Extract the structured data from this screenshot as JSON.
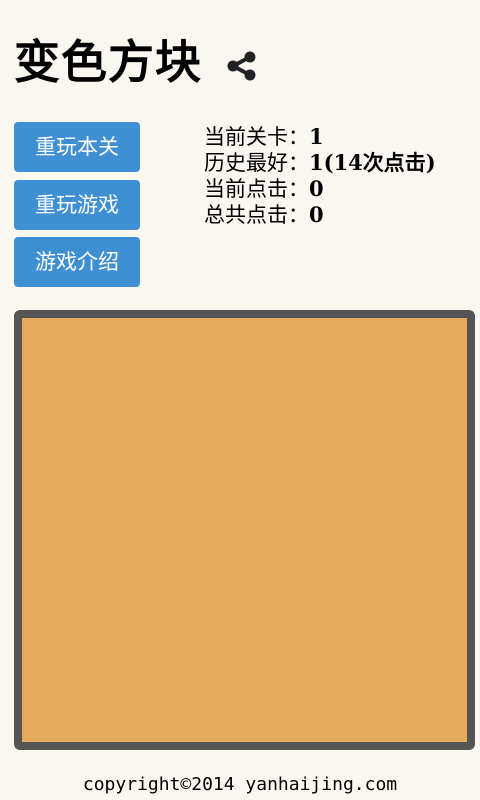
{
  "header": {
    "title": "变色方块",
    "share_icon": "share-icon"
  },
  "buttons": {
    "replay_level": "重玩本关",
    "replay_game": "重玩游戏",
    "intro": "游戏介绍"
  },
  "stats": {
    "current_level_label": "当前关卡：",
    "current_level_value": "1",
    "best_label": "历史最好：",
    "best_value": "1(14次点击)",
    "current_clicks_label": "当前点击：",
    "current_clicks_value": "0",
    "total_clicks_label": "总共点击：",
    "total_clicks_value": "0"
  },
  "board": {
    "tile_color": "#e5aa5d",
    "border_color": "#555555"
  },
  "footer": {
    "copyright": "copyright©2014 yanhaijing.com"
  },
  "colors": {
    "button_bg": "#3f8fd3",
    "page_bg": "#faf7f0"
  }
}
